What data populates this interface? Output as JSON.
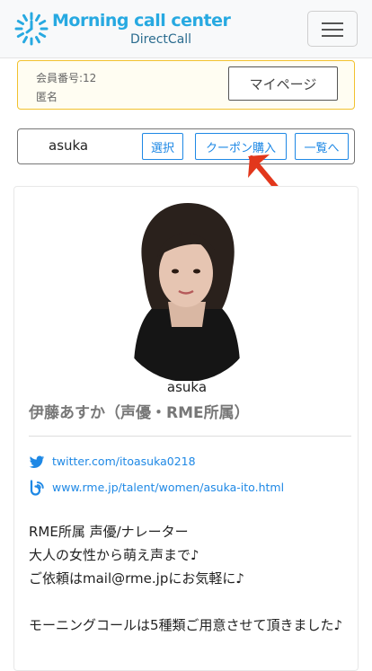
{
  "header": {
    "brand_title": "Morning call center",
    "brand_subtitle": "DirectCall",
    "logo_icon": "sunburst-clock-logo",
    "menu_icon": "hamburger-menu-icon"
  },
  "member": {
    "number_label": "会員番号:12",
    "name_label": "匿名",
    "mypage_button": "マイページ"
  },
  "actions": {
    "talent_name": "asuka",
    "select_button": "選択",
    "coupon_button": "クーポン購入",
    "list_button": "一覧へ"
  },
  "profile": {
    "caption": "asuka",
    "display_name": "伊藤あすか（声優・RME所属）",
    "links": [
      {
        "icon": "twitter-icon",
        "text": "twitter.com/itoasuka0218"
      },
      {
        "icon": "blog-icon",
        "text": "www.rme.jp/talent/women/asuka-ito.html"
      }
    ],
    "bio": "RME所属 声優/ナレーター\n大人の女性から萌え声まで♪\nご依頼はmail@rme.jpにお気軽に♪\n\nモーニングコールは5種類ご用意させて頂きました♪"
  },
  "colors": {
    "brand_blue": "#27a9e1",
    "link_blue": "#1e88e5",
    "member_border": "#f2c12e",
    "annotation_red": "#e2371c"
  }
}
